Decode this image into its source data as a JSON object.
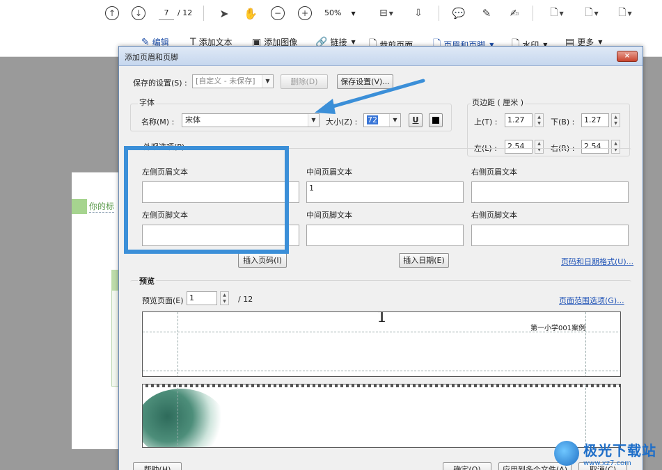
{
  "toolbar": {
    "page_current": "7",
    "page_total": "/ 12",
    "zoom": "50%",
    "items": [
      {
        "label": "编辑"
      },
      {
        "label": "添加文本"
      },
      {
        "label": "添加图像"
      },
      {
        "label": "链接"
      },
      {
        "label": "裁剪页面"
      },
      {
        "label": "页眉和页脚"
      },
      {
        "label": "水印"
      },
      {
        "label": "更多"
      }
    ]
  },
  "background": {
    "page_title": "你的标"
  },
  "dialog": {
    "title": "添加页眉和页脚",
    "close": "×",
    "saved_settings_label": "保存的设置(S) :",
    "saved_settings_value": "[自定义 - 未保存]",
    "delete_button": "删除(D)",
    "save_button": "保存设置(V)...",
    "font_group": "字体",
    "name_label": "名称(M) :",
    "font_name": "宋体",
    "size_label": "大小(Z) :",
    "font_size": "72",
    "underline_button": "U",
    "margin_group": "页边距 ( 厘米 )",
    "top_label": "上(T) :",
    "top_value": "1.27",
    "bottom_label": "下(B) :",
    "bottom_value": "1.27",
    "left_label": "左(L) :",
    "left_value": "2.54",
    "right_label": "右(R) :",
    "right_value": "2.54",
    "appearance_group": "外观选项(P)",
    "left_header_label": "左侧页眉文本",
    "center_header_label": "中间页眉文本",
    "right_header_label": "右侧页眉文本",
    "left_header_value": "",
    "center_header_value": "1",
    "right_header_value": "",
    "left_footer_label": "左侧页脚文本",
    "center_footer_label": "中间页脚文本",
    "right_footer_label": "右侧页脚文本",
    "insert_page_number": "插入页码(I)",
    "insert_date": "插入日期(E)",
    "page_date_format": "页码和日期格式(U)...",
    "preview_group": "预览",
    "preview_page_label": "预览页面(E)",
    "preview_page_value": "1",
    "preview_page_total": "/ 12",
    "page_range_options": "页面范围选项(G)...",
    "preview_header_number": "1",
    "preview_header_text": "第一小学001案例",
    "help_button": "帮助(H)",
    "ok_button": "确定(O)",
    "apply_multiple_button": "应用到多个文件(A)",
    "cancel_button": "取消(C)"
  },
  "watermark": {
    "site_name": "极光下载站",
    "url": "www.xz7.com"
  },
  "colors": {
    "annotation": "#3b8fd8",
    "link": "#1a4fb5"
  }
}
